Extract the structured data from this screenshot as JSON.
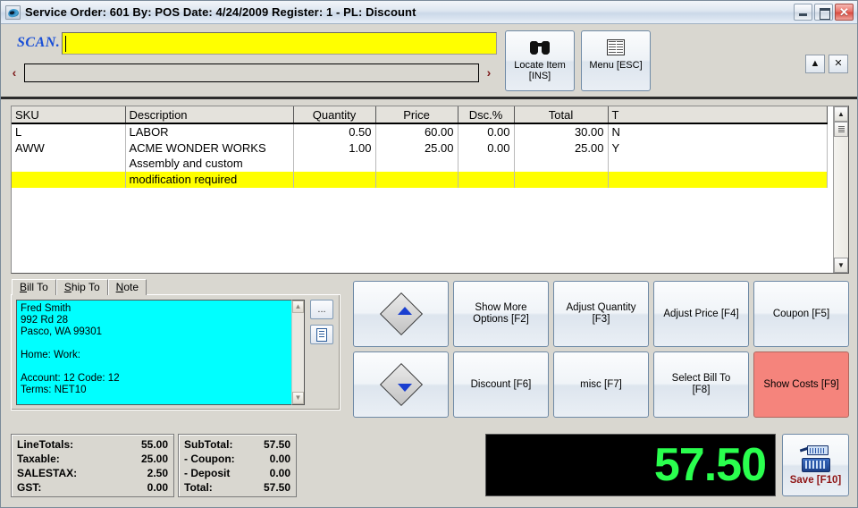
{
  "window": {
    "title": "Service Order: 601  By: POS  Date:  4/24/2009  Register: 1 - PL: Discount",
    "minimize_label": "",
    "maximize_label": "",
    "close_label": "✕"
  },
  "toolbar": {
    "scan_label": "SCAN.",
    "scan_value": "",
    "scan_placeholder": "",
    "item_value": "",
    "item_placeholder": "",
    "prev_arrow": "‹",
    "next_arrow": "›",
    "locate_item_label": "Locate Item\n[INS]",
    "menu_label": "Menu [ESC]",
    "collapse_label": "▲",
    "close_label": "✕"
  },
  "grid": {
    "columns": [
      "SKU",
      "Description",
      "Quantity",
      "Price",
      "Dsc.%",
      "Total",
      "T"
    ],
    "rows": [
      {
        "sku": "L",
        "description": "LABOR",
        "quantity": "0.50",
        "price": "60.00",
        "discount": "0.00",
        "total": "30.00",
        "t": "N",
        "highlight": false
      },
      {
        "sku": "AWW",
        "description": "ACME WONDER WORKS",
        "quantity": "1.00",
        "price": "25.00",
        "discount": "0.00",
        "total": "25.00",
        "t": "Y",
        "highlight": false
      },
      {
        "sku": "",
        "description": "Assembly and custom",
        "quantity": "",
        "price": "",
        "discount": "",
        "total": "",
        "t": "",
        "highlight": false
      },
      {
        "sku": "",
        "description": "modification required",
        "quantity": "",
        "price": "",
        "discount": "",
        "total": "",
        "t": "",
        "highlight": true
      }
    ],
    "scroll_up": "▲",
    "scroll_down": "▼"
  },
  "customer": {
    "tabs": [
      {
        "label": "Bill To",
        "active": true
      },
      {
        "label": "Ship To",
        "active": false
      },
      {
        "label": "Note",
        "active": false
      }
    ],
    "address": "Fred Smith\n992 Rd 28\nPasco, WA  99301\n\nHome:  Work:\n\nAccount: 12 Code: 12\nTerms: NET10",
    "browse_label": "...",
    "doc_label": "",
    "scroll_up": "▲",
    "scroll_down": "▼"
  },
  "function_keys": [
    {
      "name": "move-up",
      "label": "",
      "icon": "arrow-up-diamond",
      "style": "normal"
    },
    {
      "name": "show-more",
      "label": "Show More\nOptions [F2]",
      "icon": "",
      "style": "normal"
    },
    {
      "name": "adjust-quantity",
      "label": "Adjust Quantity\n[F3]",
      "icon": "",
      "style": "normal"
    },
    {
      "name": "adjust-price",
      "label": "Adjust Price [F4]",
      "icon": "",
      "style": "normal"
    },
    {
      "name": "coupon",
      "label": "Coupon [F5]",
      "icon": "",
      "style": "normal"
    },
    {
      "name": "move-down",
      "label": "",
      "icon": "arrow-down-diamond",
      "style": "normal"
    },
    {
      "name": "discount",
      "label": "Discount [F6]",
      "icon": "",
      "style": "normal"
    },
    {
      "name": "misc",
      "label": "misc [F7]",
      "icon": "",
      "style": "normal"
    },
    {
      "name": "select-bill-to",
      "label": "Select Bill To\n[F8]",
      "icon": "",
      "style": "normal"
    },
    {
      "name": "show-costs",
      "label": "Show Costs [F9]",
      "icon": "",
      "style": "danger"
    }
  ],
  "totals_left": [
    {
      "label": "LineTotals:",
      "value": "55.00"
    },
    {
      "label": "Taxable:",
      "value": "25.00"
    },
    {
      "label": "SALESTAX:",
      "value": "2.50"
    },
    {
      "label": "GST:",
      "value": "0.00"
    }
  ],
  "totals_right": [
    {
      "label": "SubTotal:",
      "value": "57.50"
    },
    {
      "label": "- Coupon:",
      "value": "0.00"
    },
    {
      "label": "- Deposit",
      "value": "0.00"
    },
    {
      "label": "Total:",
      "value": "57.50"
    }
  ],
  "display": {
    "amount": "57.50",
    "color": "#2aff4e"
  },
  "save": {
    "label": "Save [F10]",
    "color": "#8f1414"
  }
}
